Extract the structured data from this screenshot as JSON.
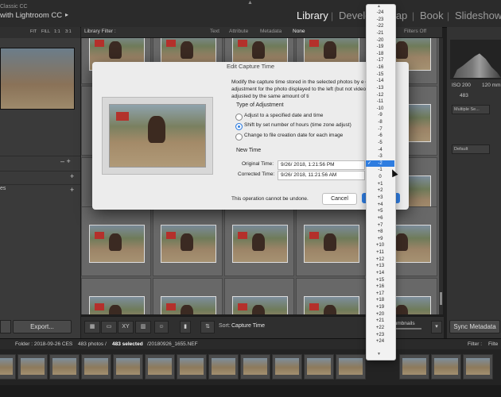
{
  "app": {
    "brand_line1": "Classic CC",
    "brand_line2": "with Lightroom CC",
    "brand_arrow": "▸"
  },
  "modules": [
    "Library",
    "Develo",
    "Map",
    "Book",
    "Slideshow"
  ],
  "left_panel": {
    "zoom_options": [
      "FIT",
      "FILL",
      "1:1",
      "3:1"
    ],
    "export_label": "Export...",
    "controls": [
      "– +",
      "+",
      "+"
    ],
    "partial_label": "es"
  },
  "filter_bar": {
    "title": "Library Filter :",
    "tabs": [
      "Text",
      "Attribute",
      "Metadata",
      "None"
    ],
    "filters_off": "Filters Off"
  },
  "toolbar": {
    "sort_label": "Sort:",
    "sort_value": "Capture Time",
    "thumbs_label": "Thumbnails"
  },
  "right_panel": {
    "iso": "ISO 200",
    "focal": "120 mm",
    "count": "483",
    "dropdown1": "Multiple Se...",
    "dropdown2": "Default",
    "sync_label": "Sync Metadata"
  },
  "filmstrip_bar": {
    "folder": "Folder : 2018-09-26 CES",
    "photos_text": "483 photos /",
    "selected_text": "483 selected",
    "filename": "/20180926_1655.NEF",
    "filter_label": "Filter :",
    "filter_value": "Filte"
  },
  "dialog": {
    "title": "Edit Capture Time",
    "description": "Modify the capture time stored in the selected photos by e correct time adjustment for the photo displayed to the left (but not videos) will be adjusted by the same amount of ti",
    "type_heading": "Type of Adjustment",
    "options": [
      {
        "label": "Adjust to a specified date and time",
        "selected": false
      },
      {
        "label": "Shift by set number of hours (time zone adjust)",
        "selected": true
      },
      {
        "label": "Change to file creation date for each image",
        "selected": false
      }
    ],
    "new_time_heading": "New Time",
    "original_label": "Original Time:",
    "original_value": "9/26/ 2018, 1:21:56 PM",
    "corrected_label": "Corrected Time:",
    "corrected_value": "9/26/ 2018, 11:21:56 AM",
    "undo_note": "This operation cannot be undone.",
    "cancel_label": "Cancel"
  },
  "dropdown": {
    "items": [
      "-24",
      "-23",
      "-22",
      "-21",
      "-20",
      "-19",
      "-18",
      "-17",
      "-16",
      "-15",
      "-14",
      "-13",
      "-12",
      "-11",
      "-10",
      "-9",
      "-8",
      "-7",
      "-6",
      "-5",
      "-4",
      "-3",
      "-2",
      "-1",
      "0",
      "+1",
      "+2",
      "+3",
      "+4",
      "+5",
      "+6",
      "+7",
      "+8",
      "+9",
      "+10",
      "+11",
      "+12",
      "+13",
      "+14",
      "+15",
      "+16",
      "+17",
      "+18",
      "+19",
      "+20",
      "+21",
      "+22",
      "+23",
      "+24"
    ],
    "selected": "-2",
    "check_mark": "✓"
  },
  "colors": {
    "accent": "#2f7de0",
    "dialog_bg": "#ececec",
    "panel_bg": "#3a3a3a"
  }
}
